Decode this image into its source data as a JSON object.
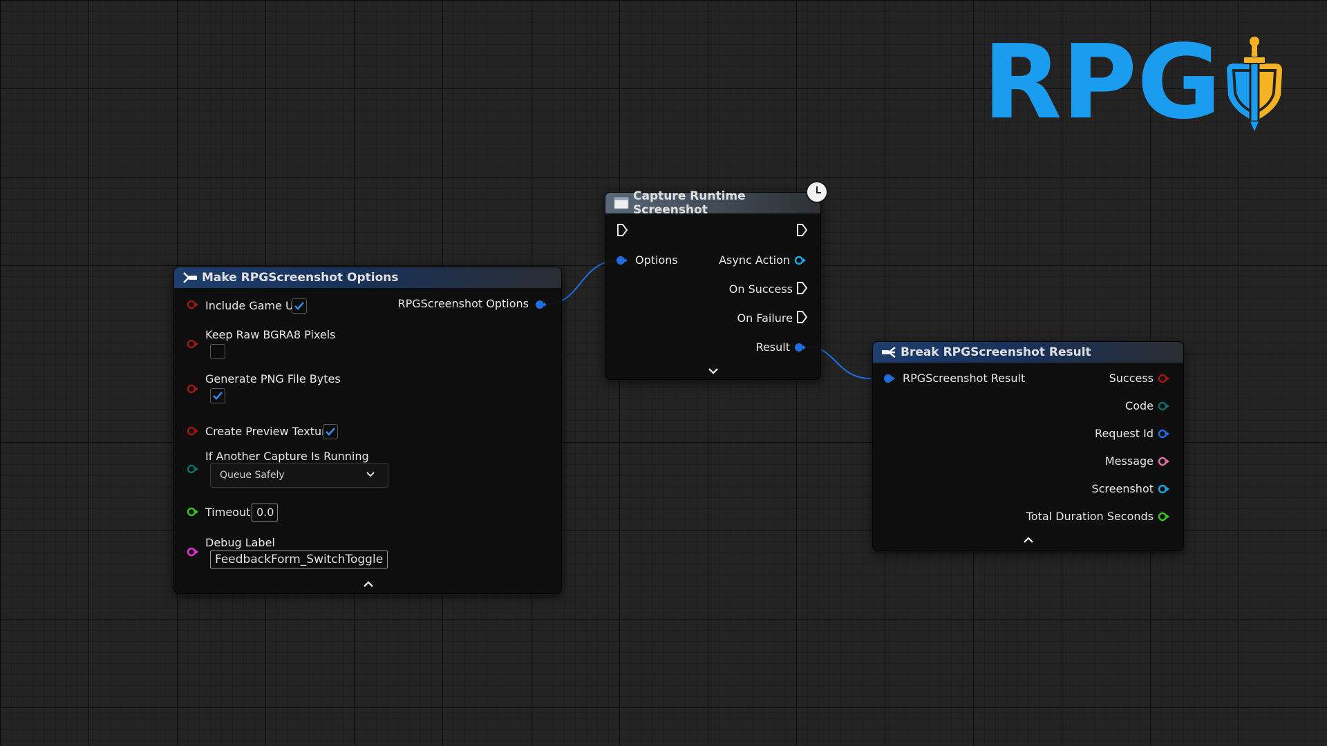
{
  "logo": {
    "text": "RPG"
  },
  "colors": {
    "struct_pin": "#1f6fe0",
    "bool_pin": "#9b1a12",
    "byte_pin": "#0e6e66",
    "float_pin": "#38c41d",
    "string_pin": "#ea2ce0",
    "object_pin": "#1aa4e0",
    "int_pin": "#1ac8b0",
    "exec_pin": "#e8e8e8",
    "logo_blue": "#1a9df0",
    "logo_gold": "#f5b324"
  },
  "nodes": {
    "make_options": {
      "title": "Make RPGScreenshot Options",
      "icon": "make-struct-icon",
      "inputs": {
        "include_game_ui": {
          "label": "Include Game UI",
          "checked": true
        },
        "keep_raw_pixels": {
          "label": "Keep Raw BGRA8 Pixels",
          "checked": false
        },
        "generate_png": {
          "label": "Generate PNG File Bytes",
          "checked": true
        },
        "create_preview": {
          "label": "Create Preview Texture",
          "checked": true
        },
        "if_running": {
          "label": "If Another Capture Is Running",
          "value": "Queue Safely"
        },
        "timeout": {
          "label": "Timeout",
          "value": "0.0"
        },
        "debug_label": {
          "label": "Debug Label",
          "value": "FeedbackForm_SwitchToggle"
        }
      },
      "output": {
        "label": "RPGScreenshot Options"
      }
    },
    "capture": {
      "title": "Capture Runtime Screenshot",
      "icon": "function-icon",
      "inputs": {
        "options": {
          "label": "Options"
        }
      },
      "outputs": {
        "async_action": {
          "label": "Async Action"
        },
        "on_success": {
          "label": "On Success"
        },
        "on_failure": {
          "label": "On Failure"
        },
        "result": {
          "label": "Result"
        }
      }
    },
    "break_result": {
      "title": "Break RPGScreenshot Result",
      "icon": "break-struct-icon",
      "input": {
        "label": "RPGScreenshot Result"
      },
      "outputs": {
        "success": {
          "label": "Success"
        },
        "code": {
          "label": "Code"
        },
        "request_id": {
          "label": "Request Id"
        },
        "message": {
          "label": "Message"
        },
        "screenshot": {
          "label": "Screenshot"
        },
        "total_duration": {
          "label": "Total Duration Seconds"
        }
      }
    }
  }
}
